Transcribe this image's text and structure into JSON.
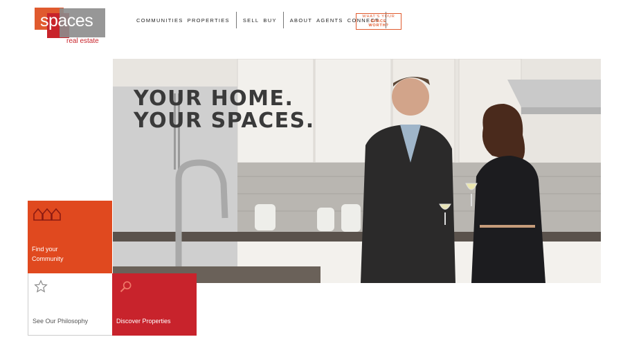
{
  "logo": {
    "word": "spaces",
    "sub": "real estate"
  },
  "nav": {
    "group1": [
      "COMMUNITIES",
      "PROPERTIES"
    ],
    "group2": [
      "SELL",
      "BUY"
    ],
    "group3": [
      "ABOUT",
      "AGENTS",
      "CONNECT"
    ],
    "cta_line1": "WHAT'S YOUR",
    "cta_line2": "SPACE",
    "cta_line3": "WORTH?"
  },
  "hero": {
    "line1": "YOUR HOME.",
    "line2": "YOUR SPACES."
  },
  "tiles": {
    "community": {
      "line1": "Find your",
      "line2": "Community",
      "icon": "houses-icon"
    },
    "philosophy": {
      "label": "See Our Philosophy",
      "icon": "star-icon"
    },
    "discover": {
      "label": "Discover Properties",
      "icon": "search-icon"
    }
  },
  "colors": {
    "accent_orange": "#e0491f",
    "accent_red": "#c8232c",
    "grey": "#8c8c8c"
  }
}
